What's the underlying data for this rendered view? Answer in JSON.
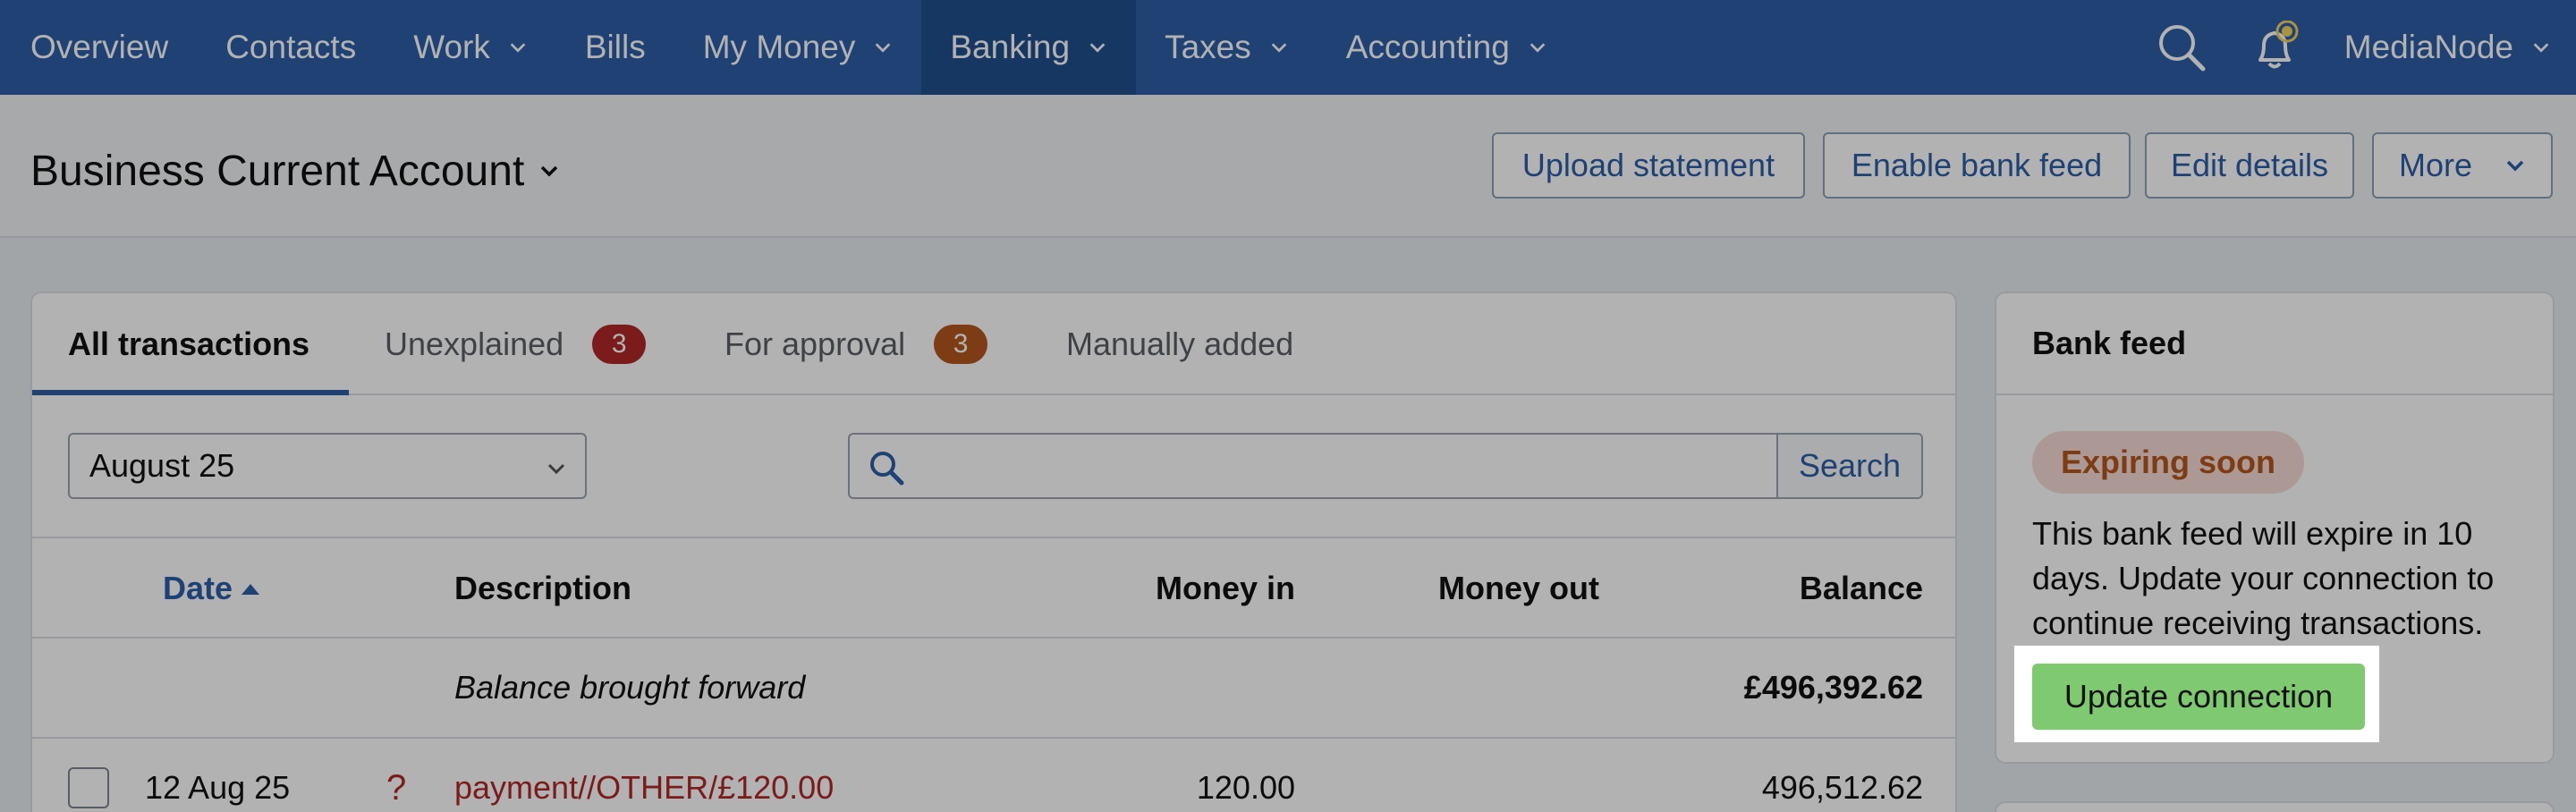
{
  "nav": {
    "items": [
      {
        "label": "Overview",
        "dropdown": false
      },
      {
        "label": "Contacts",
        "dropdown": false
      },
      {
        "label": "Work",
        "dropdown": true
      },
      {
        "label": "Bills",
        "dropdown": false
      },
      {
        "label": "My Money",
        "dropdown": true
      },
      {
        "label": "Banking",
        "dropdown": true,
        "active": true
      },
      {
        "label": "Taxes",
        "dropdown": true
      },
      {
        "label": "Accounting",
        "dropdown": true
      }
    ],
    "user": "MediaNode",
    "icons": [
      "search-icon",
      "bell-icon"
    ]
  },
  "header": {
    "title": "Business Current Account",
    "buttons": {
      "upload": "Upload statement",
      "enable_feed": "Enable bank feed",
      "edit": "Edit details",
      "more": "More"
    }
  },
  "tabs": {
    "all": "All transactions",
    "unexplained": "Unexplained",
    "unexplained_count": "3",
    "approval": "For approval",
    "approval_count": "3",
    "manual": "Manually added"
  },
  "filters": {
    "period": "August 25",
    "search_placeholder": "",
    "search_button": "Search"
  },
  "table": {
    "columns": {
      "date": "Date",
      "description": "Description",
      "money_in": "Money in",
      "money_out": "Money out",
      "balance": "Balance"
    },
    "brought_forward": {
      "description": "Balance brought forward",
      "balance": "£496,392.62"
    },
    "rows": [
      {
        "date": "12 Aug 25",
        "flag": "?",
        "description": "payment//OTHER/£120.00",
        "money_in": "120.00",
        "money_out": "",
        "balance": "496,512.62"
      }
    ]
  },
  "bank_feed": {
    "title": "Bank feed",
    "status": "Expiring soon",
    "message": "This bank feed will expire in 10 days. Update your connection to continue receiving transactions.",
    "button": "Update connection"
  },
  "colors": {
    "nav_bg": "#2d5ea7",
    "nav_active": "#22508f",
    "link": "#2d5ea7",
    "danger": "#b12828",
    "warning": "#b4561e",
    "success_button": "#7fc971",
    "warning_pill_bg": "#f6dcd6"
  }
}
